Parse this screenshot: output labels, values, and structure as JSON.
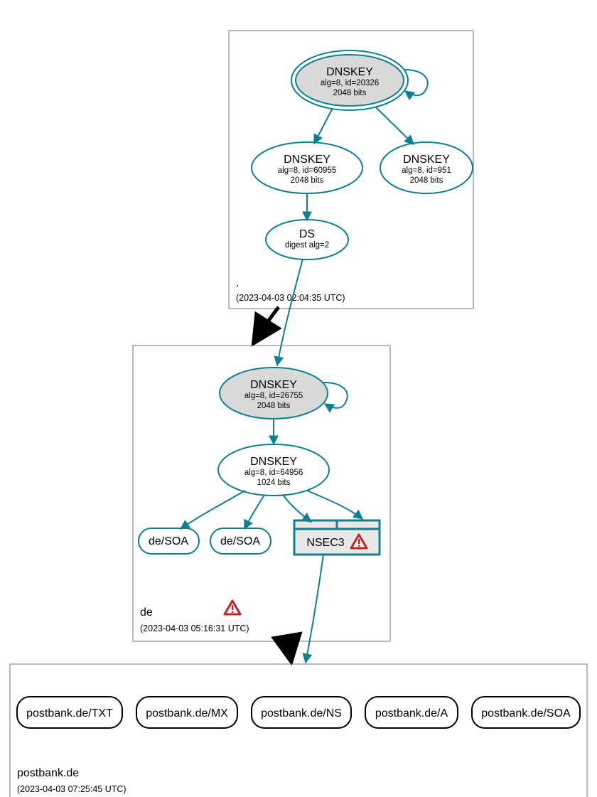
{
  "colors": {
    "stroke": "#0d8191",
    "fill_secure": "#d9d9d9",
    "fill_plain": "#ffffff",
    "box_stroke": "#757575",
    "black": "#000000",
    "warn_red": "#c42126",
    "nsec_fill": "#e8e8e8"
  },
  "root": {
    "label": ".",
    "ts": "(2023-04-03 02:04:35 UTC)",
    "ksk": {
      "title": "DNSKEY",
      "sub1": "alg=8, id=20326",
      "sub2": "2048 bits"
    },
    "zsk1": {
      "title": "DNSKEY",
      "sub1": "alg=8, id=60955",
      "sub2": "2048 bits"
    },
    "zsk2": {
      "title": "DNSKEY",
      "sub1": "alg=8, id=951",
      "sub2": "2048 bits"
    },
    "ds": {
      "title": "DS",
      "sub1": "digest alg=2"
    }
  },
  "de": {
    "label": "de",
    "ts": "(2023-04-03 05:16:31 UTC)",
    "ksk": {
      "title": "DNSKEY",
      "sub1": "alg=8, id=26755",
      "sub2": "2048 bits"
    },
    "zsk": {
      "title": "DNSKEY",
      "sub1": "alg=8, id=64956",
      "sub2": "1024 bits"
    },
    "soa1": "de/SOA",
    "soa2": "de/SOA",
    "nsec3": "NSEC3"
  },
  "leaf": {
    "label": "postbank.de",
    "ts": "(2023-04-03 07:25:45 UTC)",
    "records": [
      "postbank.de/TXT",
      "postbank.de/MX",
      "postbank.de/NS",
      "postbank.de/A",
      "postbank.de/SOA"
    ]
  }
}
